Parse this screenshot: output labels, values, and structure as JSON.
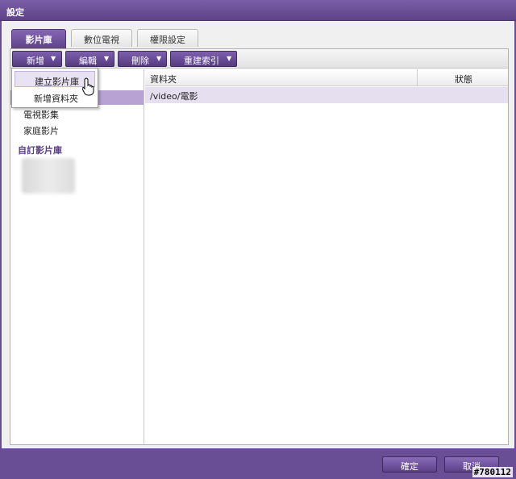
{
  "window": {
    "title": "設定"
  },
  "tabs": [
    {
      "label": "影片庫",
      "active": true
    },
    {
      "label": "數位電視",
      "active": false
    },
    {
      "label": "權限設定",
      "active": false
    }
  ],
  "toolbar": {
    "buttons": [
      {
        "label": "新增",
        "icon": "chevron-down-icon"
      },
      {
        "label": "編輯",
        "icon": "chevron-down-icon"
      },
      {
        "label": "刪除",
        "icon": "chevron-down-icon"
      },
      {
        "label": "重建索引",
        "icon": "chevron-down-icon"
      }
    ]
  },
  "dropdown": {
    "items": [
      {
        "label": "建立影片庫",
        "hovered": true
      },
      {
        "label": "新增資料夾",
        "hovered": false
      }
    ]
  },
  "sidebar": {
    "items": [
      "電視影集",
      "家庭影片"
    ],
    "custom_header": "自訂影片庫"
  },
  "grid": {
    "columns": [
      "資料夾",
      "狀態"
    ],
    "rows": [
      {
        "folder": "/video/電影",
        "status": ""
      }
    ]
  },
  "footer": {
    "ok_label": "確定",
    "cancel_label": "取消"
  },
  "watermark": "#780112",
  "colors": {
    "accent": "#6a4e95",
    "selected_row": "#e6dff0",
    "sidebar_selected": "#b7a2d3"
  }
}
